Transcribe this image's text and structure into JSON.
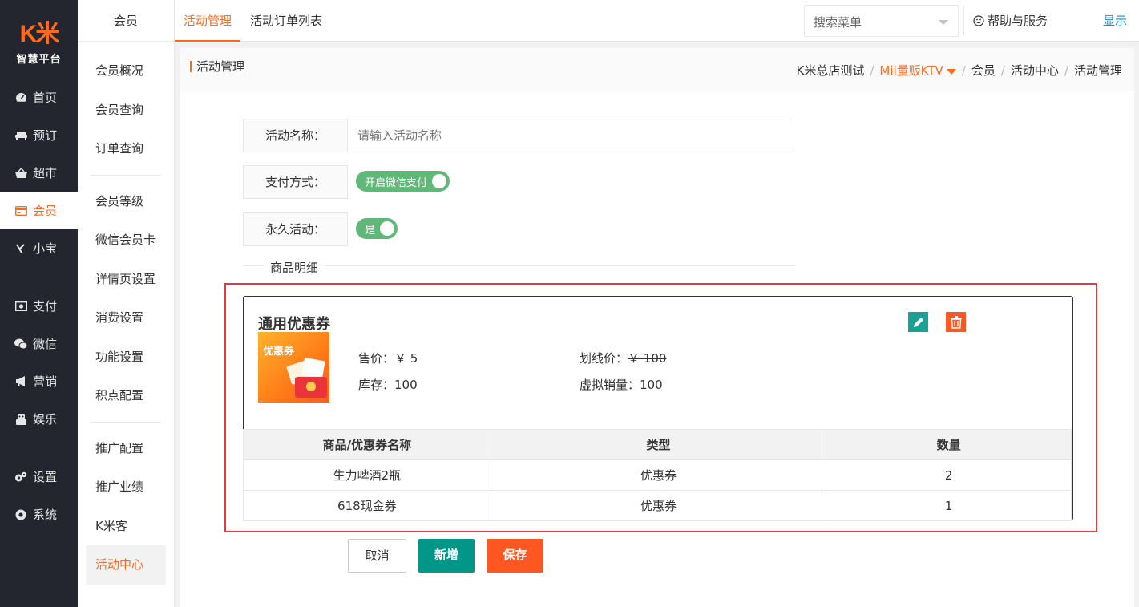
{
  "brand": {
    "logo_text": "K米",
    "logo_sub": "智慧平台"
  },
  "sidebar": {
    "items": [
      {
        "label": "首页",
        "icon": "dashboard-icon"
      },
      {
        "label": "预订",
        "icon": "sofa-icon"
      },
      {
        "label": "超市",
        "icon": "basket-icon"
      },
      {
        "label": "会员",
        "icon": "card-icon",
        "active": true
      },
      {
        "label": "小宝",
        "icon": "xiaobao-icon"
      },
      {
        "label": "支付",
        "icon": "money-icon"
      },
      {
        "label": "微信",
        "icon": "wechat-icon"
      },
      {
        "label": "营销",
        "icon": "megaphone-icon"
      },
      {
        "label": "娱乐",
        "icon": "robot-icon"
      },
      {
        "label": "设置",
        "icon": "gears-icon"
      },
      {
        "label": "系统",
        "icon": "chrome-icon"
      }
    ]
  },
  "subnav": {
    "title": "会员",
    "group1": [
      "会员概况",
      "会员查询",
      "订单查询"
    ],
    "group2": [
      "会员等级",
      "微信会员卡",
      "详情页设置",
      "消费设置",
      "功能设置",
      "积点配置"
    ],
    "group3": [
      "推广配置",
      "推广业绩",
      "K米客",
      "活动中心"
    ]
  },
  "topbar": {
    "tabs": [
      "活动管理",
      "活动订单列表"
    ],
    "search_placeholder": "搜索菜单",
    "help": "帮助与服务",
    "show": "显示"
  },
  "page": {
    "title": "活动管理",
    "breadcrumb": {
      "store": "K米总店测试",
      "venue": "Mii量贩KTV",
      "c1": "会员",
      "c2": "活动中心",
      "c3": "活动管理"
    }
  },
  "form": {
    "name_label": "活动名称：",
    "name_placeholder": "请输入活动名称",
    "pay_label": "支付方式：",
    "pay_switch": "开启微信支付",
    "forever_label": "永久活动：",
    "forever_switch": "是",
    "section_title": "商品明细"
  },
  "card": {
    "title": "通用优惠券",
    "image_text": "优惠券",
    "price": "售价：￥ 5",
    "original_label": "划线价：",
    "original_value": "￥ 100",
    "stock": "库存：100",
    "virtual_sales": "虚拟销量：100"
  },
  "goods_table": {
    "headers": [
      "商品/优惠券名称",
      "类型",
      "数量"
    ],
    "rows": [
      [
        "生力啤酒2瓶",
        "优惠券",
        "2"
      ],
      [
        "618现金券",
        "优惠券",
        "1"
      ]
    ]
  },
  "buttons": {
    "cancel": "取消",
    "add": "新增",
    "save": "保存"
  },
  "colors": {
    "accent": "#ff6a1a",
    "sidebar_bg": "#23262e",
    "switch_green": "#5fb878",
    "teal": "#009688",
    "danger": "#ff5722",
    "highlight_red": "#e8383d"
  }
}
